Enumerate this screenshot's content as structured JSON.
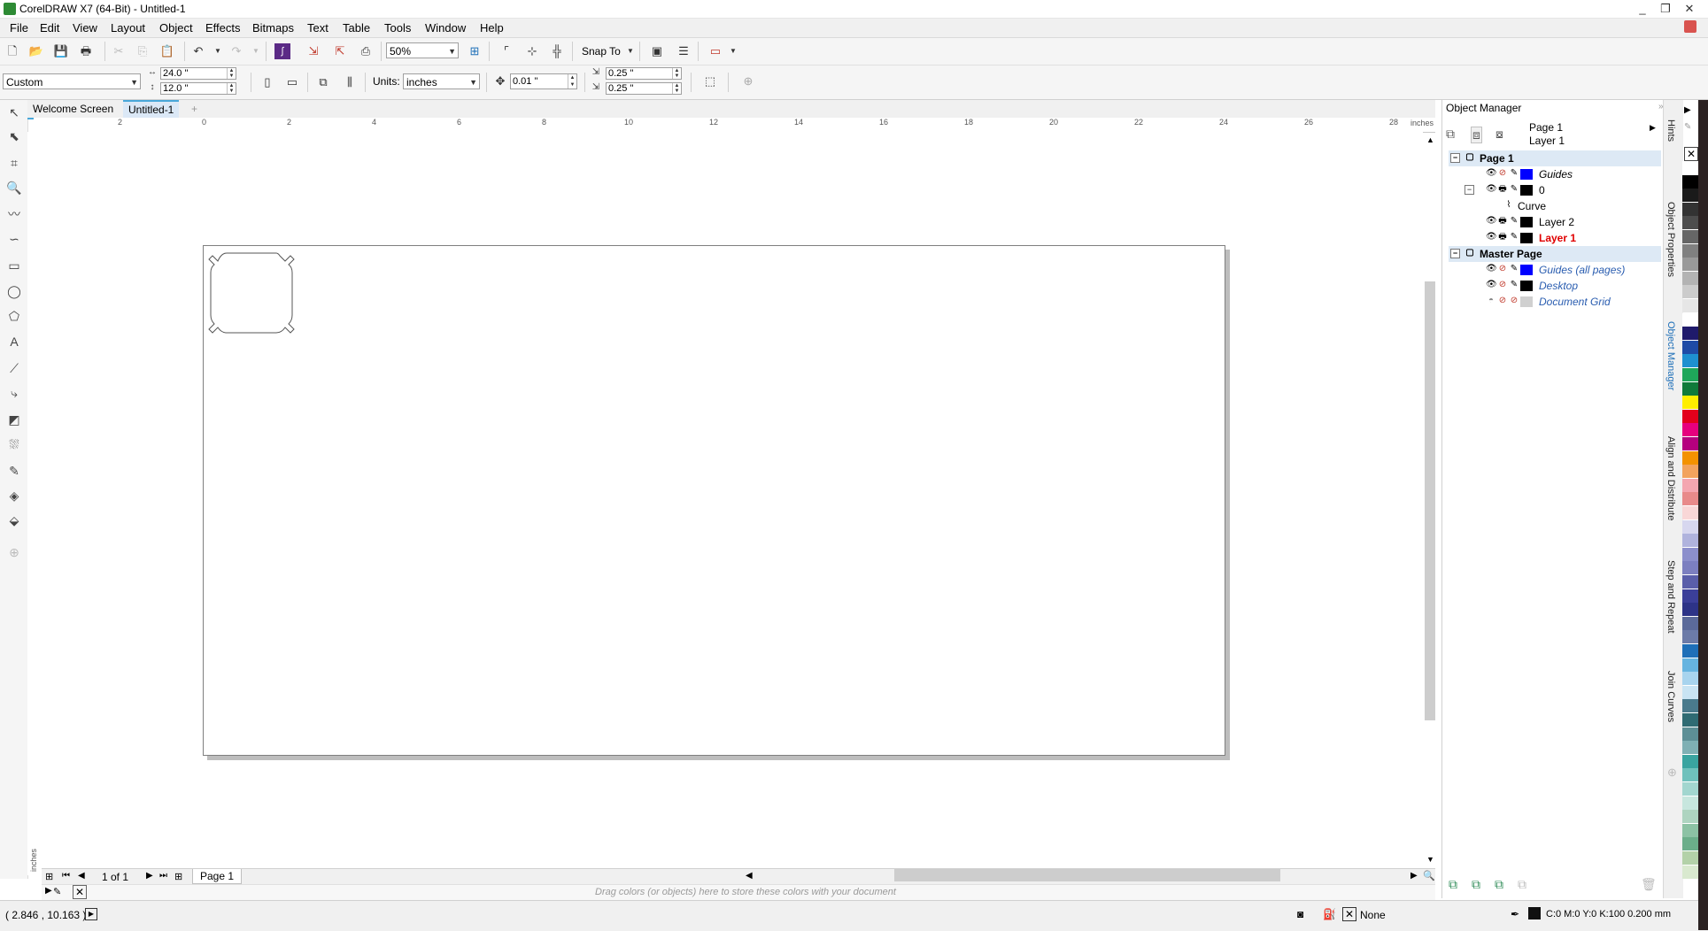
{
  "window": {
    "title": "CorelDRAW X7 (64-Bit) - Untitled-1",
    "controls": [
      "_",
      "❐",
      "✕"
    ]
  },
  "menu": [
    "File",
    "Edit",
    "View",
    "Layout",
    "Object",
    "Effects",
    "Bitmaps",
    "Text",
    "Table",
    "Tools",
    "Window",
    "Help"
  ],
  "standard_toolbar": {
    "zoom_value": "50%",
    "snap_to_label": "Snap To"
  },
  "property_bar": {
    "page_preset": "Custom",
    "page_width": "24.0 \"",
    "page_height": "12.0 \"",
    "units_label": "Units:",
    "units_value": "inches",
    "nudge_value": "0.01 \"",
    "duplicate_x": "0.25 \"",
    "duplicate_y": "0.25 \""
  },
  "doc_tabs": {
    "welcome": "Welcome Screen",
    "active": "Untitled-1",
    "add": "+"
  },
  "ruler": {
    "h_labels": [
      "2",
      "0",
      "2",
      "4",
      "6",
      "8",
      "10",
      "12",
      "14",
      "16",
      "18",
      "20",
      "22",
      "24",
      "26",
      "28"
    ],
    "h_units": "inches",
    "v_units": "inches"
  },
  "page_nav": {
    "counter": "1 of 1",
    "page_tab": "Page 1"
  },
  "doc_palette_hint": "Drag colors (or objects) here to store these colors with your document",
  "status": {
    "coords": "( 2.846 , 10.163 )",
    "fill": "None",
    "outline": "C:0 M:0 Y:0 K:100  0.200 mm"
  },
  "object_manager": {
    "title": "Object Manager",
    "current_page": "Page 1",
    "current_layer": "Layer 1",
    "tree": [
      {
        "label": "Page 1",
        "level": 0,
        "type": "page"
      },
      {
        "label": "Guides",
        "level": 1,
        "swatch": "#0000ff",
        "italic": true
      },
      {
        "label": "0",
        "level": 1,
        "swatch": "#000000",
        "expander": true
      },
      {
        "label": "Curve",
        "level": 2,
        "type": "curve"
      },
      {
        "label": "Layer 2",
        "level": 1,
        "swatch": "#000000"
      },
      {
        "label": "Layer 1",
        "level": 1,
        "swatch": "#000000",
        "active": true
      },
      {
        "label": "Master Page",
        "level": 0,
        "type": "page"
      },
      {
        "label": "Guides (all pages)",
        "level": 1,
        "swatch": "#0000ff",
        "italic": true,
        "master": true
      },
      {
        "label": "Desktop",
        "level": 1,
        "swatch": "#000000",
        "italic": true,
        "master": true
      },
      {
        "label": "Document Grid",
        "level": 1,
        "swatch": "#d0d0d0",
        "italic": true,
        "master": true
      }
    ]
  },
  "docker_tabs": [
    "Hints",
    "Object Properties",
    "Object Manager",
    "Align and Distribute",
    "Step and Repeat",
    "Join Curves"
  ],
  "palette_colors": [
    "#ffffff",
    "#000000",
    "#1a1a1a",
    "#333333",
    "#4d4d4d",
    "#666666",
    "#808080",
    "#999999",
    "#b3b3b3",
    "#cccccc",
    "#e6e6e6",
    "#ffffff",
    "#1f1a6b",
    "#1f4ba6",
    "#1e90d0",
    "#1fa65a",
    "#0f7a3a",
    "#ffee00",
    "#e3001b",
    "#e6007e",
    "#b5007e",
    "#f39200",
    "#f2a35e",
    "#f4a6b0",
    "#e88a8a",
    "#f9d7d7",
    "#d7d7ef",
    "#b0b3dd",
    "#8c8fcc",
    "#7c7fc0",
    "#5a5eaa",
    "#3b3f99",
    "#2d3387",
    "#5b6a9a",
    "#6c7ba8",
    "#1e6fb8",
    "#66b4e0",
    "#a8d4ee",
    "#c9e4f3",
    "#4a7a8c",
    "#2f6b73",
    "#5d8f96",
    "#7fb0b4",
    "#3aa4a0",
    "#6fc1bc",
    "#a2d6cf",
    "#c7e6de",
    "#aed4c0",
    "#8cc2a4",
    "#6bae8a",
    "#b3d1a8",
    "#d9e9cf"
  ]
}
